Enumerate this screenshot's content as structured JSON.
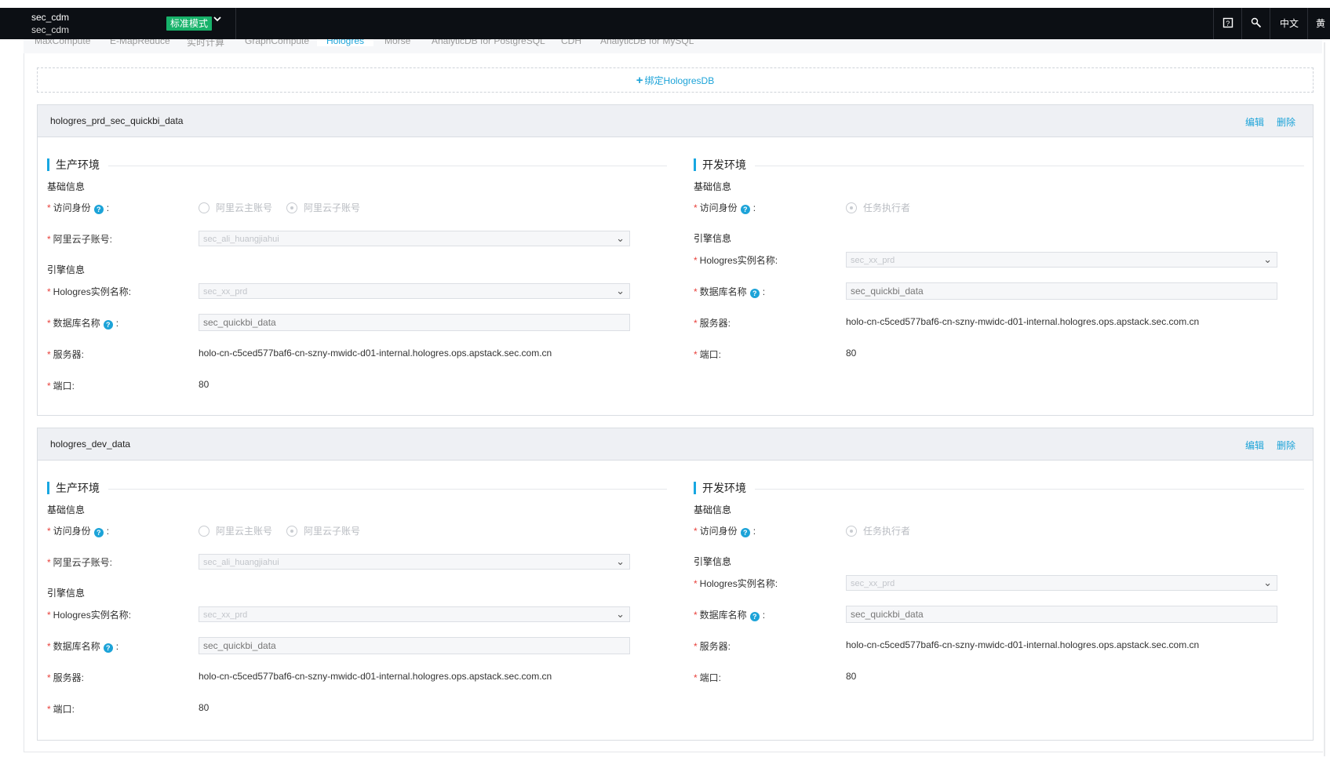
{
  "header": {
    "project_name": "sec_cdm",
    "project_sub": "sec_cdm",
    "mode_badge": "标准模式",
    "chevron_icon": "chevron-down-icon",
    "help_icon": "help-book-icon",
    "tool_icon": "wrench-icon",
    "language": "中文",
    "user_label": "黄"
  },
  "tabs": [
    {
      "label": "MaxCompute"
    },
    {
      "label": "E-MapReduce"
    },
    {
      "label": "实时计算"
    },
    {
      "label": "GraphCompute"
    },
    {
      "label": "Hologres",
      "active": true
    },
    {
      "label": "Morse"
    },
    {
      "label": "AnalyticDB for PostgreSQL"
    },
    {
      "label": "CDH"
    },
    {
      "label": "AnalyticDB for MySQL"
    }
  ],
  "bind_button": "绑定HologresDB",
  "accent_color": "#1ca3d8",
  "cards": [
    {
      "name": "hologres_prd_sec_quickbi_data",
      "edit": "编辑",
      "delete": "删除",
      "prod": {
        "title": "生产环境",
        "basic": "基础信息",
        "identity_label": "访问身份",
        "radio_main": "阿里云主账号",
        "radio_sub": "阿里云子账号",
        "subaccount_label": "阿里云子账号:",
        "subaccount_value": "sec_ali_huangjiahui",
        "engine": "引擎信息",
        "instance_label": "Hologres实例名称:",
        "instance_value": "sec_xx_prd",
        "db_label": "数据库名称",
        "db_value": "sec_quickbi_data",
        "server_label": "服务器:",
        "server_value": "holo-cn-c5ced577baf6-cn-szny-mwidc-d01-internal.hologres.ops.apstack.sec.com.cn",
        "port_label": "端口:",
        "port_value": "80"
      },
      "dev": {
        "title": "开发环境",
        "basic": "基础信息",
        "identity_label": "访问身份",
        "radio_exec": "任务执行者",
        "engine": "引擎信息",
        "instance_label": "Hologres实例名称:",
        "instance_value": "sec_xx_prd",
        "db_label": "数据库名称",
        "db_value": "sec_quickbi_data",
        "server_label": "服务器:",
        "server_value": "holo-cn-c5ced577baf6-cn-szny-mwidc-d01-internal.hologres.ops.apstack.sec.com.cn",
        "port_label": "端口:",
        "port_value": "80"
      }
    },
    {
      "name": "hologres_dev_data",
      "edit": "编辑",
      "delete": "删除",
      "prod": {
        "title": "生产环境",
        "basic": "基础信息",
        "identity_label": "访问身份",
        "radio_main": "阿里云主账号",
        "radio_sub": "阿里云子账号",
        "subaccount_label": "阿里云子账号:",
        "subaccount_value": "sec_ali_huangjiahui",
        "engine": "引擎信息",
        "instance_label": "Hologres实例名称:",
        "instance_value": "sec_xx_prd",
        "db_label": "数据库名称",
        "db_value": "sec_quickbi_data",
        "server_label": "服务器:",
        "server_value": "holo-cn-c5ced577baf6-cn-szny-mwidc-d01-internal.hologres.ops.apstack.sec.com.cn",
        "port_label": "端口:",
        "port_value": "80"
      },
      "dev": {
        "title": "开发环境",
        "basic": "基础信息",
        "identity_label": "访问身份",
        "radio_exec": "任务执行者",
        "engine": "引擎信息",
        "instance_label": "Hologres实例名称:",
        "instance_value": "sec_xx_prd",
        "db_label": "数据库名称",
        "db_value": "sec_quickbi_data",
        "server_label": "服务器:",
        "server_value": "holo-cn-c5ced577baf6-cn-szny-mwidc-d01-internal.hologres.ops.apstack.sec.com.cn",
        "port_label": "端口:",
        "port_value": "80"
      }
    }
  ]
}
